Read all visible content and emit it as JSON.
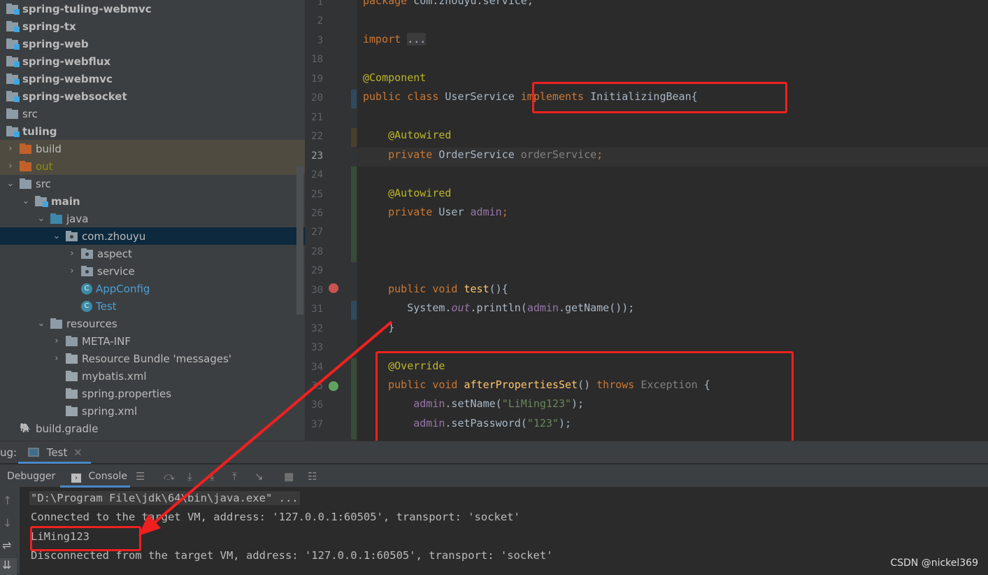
{
  "project_tree": [
    {
      "label": "spring-tuling-webmvc",
      "icon": "module-folder-icon",
      "bold": true,
      "indent": 0,
      "chev": ""
    },
    {
      "label": "spring-tx",
      "icon": "module-folder-icon",
      "bold": true,
      "indent": 0,
      "chev": ""
    },
    {
      "label": "spring-web",
      "icon": "module-folder-icon",
      "bold": true,
      "indent": 0,
      "chev": ""
    },
    {
      "label": "spring-webflux",
      "icon": "module-folder-icon",
      "bold": true,
      "indent": 0,
      "chev": ""
    },
    {
      "label": "spring-webmvc",
      "icon": "module-folder-icon",
      "bold": true,
      "indent": 0,
      "chev": ""
    },
    {
      "label": "spring-websocket",
      "icon": "module-folder-icon",
      "bold": true,
      "indent": 0,
      "chev": ""
    },
    {
      "label": "src",
      "icon": "folder-icon",
      "bold": false,
      "indent": 0,
      "chev": ""
    },
    {
      "label": "tuling",
      "icon": "module-folder-icon",
      "bold": true,
      "indent": 0,
      "chev": ""
    },
    {
      "label": "build",
      "icon": "excluded-folder-icon",
      "indent": 0,
      "chev": ">",
      "state": "ignored"
    },
    {
      "label": "out",
      "icon": "excluded-folder-icon",
      "indent": 0,
      "chev": ">",
      "state": "ignored",
      "color": "#8f8f00"
    },
    {
      "label": "src",
      "icon": "folder-icon",
      "indent": 0,
      "chev": "v"
    },
    {
      "label": "main",
      "icon": "module-folder-icon",
      "bold": true,
      "indent": 1,
      "chev": "v"
    },
    {
      "label": "java",
      "icon": "source-folder-icon",
      "indent": 2,
      "chev": "v"
    },
    {
      "label": "com.zhouyu",
      "icon": "package-icon",
      "indent": 3,
      "chev": "v",
      "state": "selected"
    },
    {
      "label": "aspect",
      "icon": "package-icon",
      "indent": 4,
      "chev": ">"
    },
    {
      "label": "service",
      "icon": "package-icon",
      "indent": 4,
      "chev": ">"
    },
    {
      "label": "AppConfig",
      "icon": "class-icon",
      "indent": 4,
      "chev": "",
      "color": "#4a9fd6"
    },
    {
      "label": "Test",
      "icon": "class-run-icon",
      "indent": 4,
      "chev": "",
      "color": "#4a9fd6"
    },
    {
      "label": "resources",
      "icon": "resources-folder-icon",
      "indent": 2,
      "chev": "v"
    },
    {
      "label": "META-INF",
      "icon": "folder-icon",
      "indent": 3,
      "chev": ">"
    },
    {
      "label": "Resource Bundle 'messages'",
      "icon": "resource-bundle-icon",
      "indent": 3,
      "chev": ">"
    },
    {
      "label": "mybatis.xml",
      "icon": "xml-file-icon",
      "indent": 3,
      "chev": ""
    },
    {
      "label": "spring.properties",
      "icon": "properties-file-icon",
      "indent": 3,
      "chev": ""
    },
    {
      "label": "spring.xml",
      "icon": "spring-xml-icon",
      "indent": 3,
      "chev": ""
    },
    {
      "label": "build.gradle",
      "icon": "gradle-icon",
      "indent": 0,
      "chev": ""
    }
  ],
  "editor": {
    "current_line": "23",
    "lines": [
      {
        "n": "1",
        "t": [
          [
            "kw",
            "package "
          ],
          [
            "",
            "com.zhouyu.service;"
          ]
        ]
      },
      {
        "n": "2",
        "t": []
      },
      {
        "n": "3",
        "t": [
          [
            "kw",
            "import "
          ],
          [
            "fold",
            "..."
          ]
        ]
      },
      {
        "n": "18",
        "t": []
      },
      {
        "n": "19",
        "t": [
          [
            "an",
            "@Component"
          ]
        ]
      },
      {
        "n": "20",
        "t": [
          [
            "kw",
            "public class "
          ],
          [
            "",
            "UserService "
          ],
          [
            "kw",
            "implements "
          ],
          [
            "",
            "InitializingBean{"
          ]
        ]
      },
      {
        "n": "21",
        "t": []
      },
      {
        "n": "22",
        "t": [
          [
            "",
            "    "
          ],
          [
            "an",
            "@Autowired"
          ]
        ]
      },
      {
        "n": "23",
        "t": [
          [
            "",
            "    "
          ],
          [
            "kw",
            "private "
          ],
          [
            "",
            "OrderService "
          ],
          [
            "gr",
            "orderService"
          ],
          [
            "kw",
            ";"
          ]
        ]
      },
      {
        "n": "24",
        "t": []
      },
      {
        "n": "25",
        "t": [
          [
            "",
            "    "
          ],
          [
            "an",
            "@Autowired"
          ]
        ]
      },
      {
        "n": "26",
        "t": [
          [
            "",
            "    "
          ],
          [
            "kw",
            "private "
          ],
          [
            "",
            "User "
          ],
          [
            "fd",
            "admin"
          ],
          [
            "kw",
            ";"
          ]
        ]
      },
      {
        "n": "27",
        "t": []
      },
      {
        "n": "28",
        "t": []
      },
      {
        "n": "29",
        "t": []
      },
      {
        "n": "30",
        "t": [
          [
            "",
            "    "
          ],
          [
            "kw",
            "public void "
          ],
          [
            "fn",
            "test"
          ],
          [
            "",
            "(){"
          ]
        ]
      },
      {
        "n": "31",
        "t": [
          [
            "",
            "       System."
          ],
          [
            "it",
            "out"
          ],
          [
            "",
            ".println("
          ],
          [
            "fd",
            "admin"
          ],
          [
            "",
            ".getName());"
          ]
        ]
      },
      {
        "n": "32",
        "t": [
          [
            "",
            "    }"
          ]
        ]
      },
      {
        "n": "33",
        "t": []
      },
      {
        "n": "34",
        "t": [
          [
            "",
            "    "
          ],
          [
            "an",
            "@Override"
          ]
        ]
      },
      {
        "n": "35",
        "t": [
          [
            "",
            "    "
          ],
          [
            "kw",
            "public void "
          ],
          [
            "fn",
            "afterPropertiesSet"
          ],
          [
            "",
            "() "
          ],
          [
            "kw",
            "throws "
          ],
          [
            "gr",
            "Exception "
          ],
          [
            "",
            "{"
          ]
        ]
      },
      {
        "n": "36",
        "t": [
          [
            "",
            "        "
          ],
          [
            "fd",
            "admin"
          ],
          [
            "",
            ".setName("
          ],
          [
            "st",
            "\"LiMing123\""
          ],
          [
            "",
            ");"
          ]
        ]
      },
      {
        "n": "37",
        "t": [
          [
            "",
            "        "
          ],
          [
            "fd",
            "admin"
          ],
          [
            "",
            ".setPassword("
          ],
          [
            "st",
            "\"123\""
          ],
          [
            "",
            ");"
          ]
        ]
      }
    ]
  },
  "debug": {
    "label": "ug:",
    "session_tab": "Test",
    "tabs": [
      "Debugger",
      "Console"
    ],
    "active_tab": "Console",
    "output": [
      "\"D:\\Program File\\jdk\\64\\bin\\java.exe\" ...",
      "Connected to the target VM, address: '127.0.0.1:60505', transport: 'socket'",
      "LiMing123",
      "Disconnected from the target VM, address: '127.0.0.1:60505', transport: 'socket'"
    ]
  },
  "watermark": "CSDN @nickel369",
  "colors": {
    "annotation_box": "#f02020",
    "selection": "#0d293e"
  }
}
